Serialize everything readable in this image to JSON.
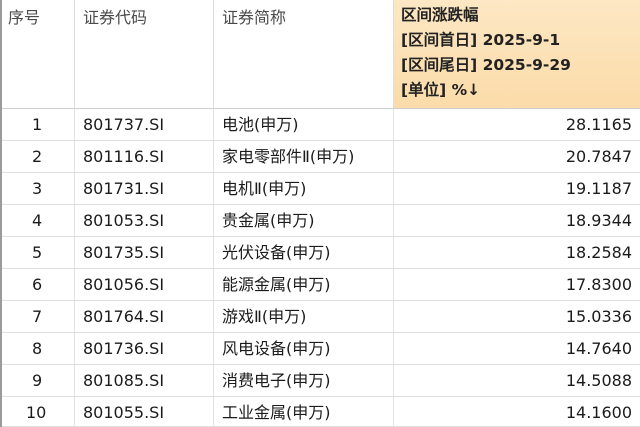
{
  "header": {
    "col_seq": "序号",
    "col_code": "证券代码",
    "col_name": "证券简称",
    "col_change": {
      "line1": "区间涨跌幅",
      "line2": "[区间首日] 2025-9-1",
      "line3": "[区间尾日] 2025-9-29",
      "line4": "[单位] %",
      "sort_indicator": "↓"
    }
  },
  "rows": [
    {
      "seq": "1",
      "code": "801737.SI",
      "name": "电池(申万)",
      "value": "28.1165"
    },
    {
      "seq": "2",
      "code": "801116.SI",
      "name": "家电零部件Ⅱ(申万)",
      "value": "20.7847"
    },
    {
      "seq": "3",
      "code": "801731.SI",
      "name": "电机Ⅱ(申万)",
      "value": "19.1187"
    },
    {
      "seq": "4",
      "code": "801053.SI",
      "name": "贵金属(申万)",
      "value": "18.9344"
    },
    {
      "seq": "5",
      "code": "801735.SI",
      "name": "光伏设备(申万)",
      "value": "18.2584"
    },
    {
      "seq": "6",
      "code": "801056.SI",
      "name": "能源金属(申万)",
      "value": "17.8300"
    },
    {
      "seq": "7",
      "code": "801764.SI",
      "name": "游戏Ⅱ(申万)",
      "value": "15.0336"
    },
    {
      "seq": "8",
      "code": "801736.SI",
      "name": "风电设备(申万)",
      "value": "14.7640"
    },
    {
      "seq": "9",
      "code": "801085.SI",
      "name": "消费电子(申万)",
      "value": "14.5088"
    },
    {
      "seq": "10",
      "code": "801055.SI",
      "name": "工业金属(申万)",
      "value": "14.1600"
    }
  ],
  "colors": {
    "header_highlight": "#fbdca9",
    "grid_line": "#dedede"
  }
}
